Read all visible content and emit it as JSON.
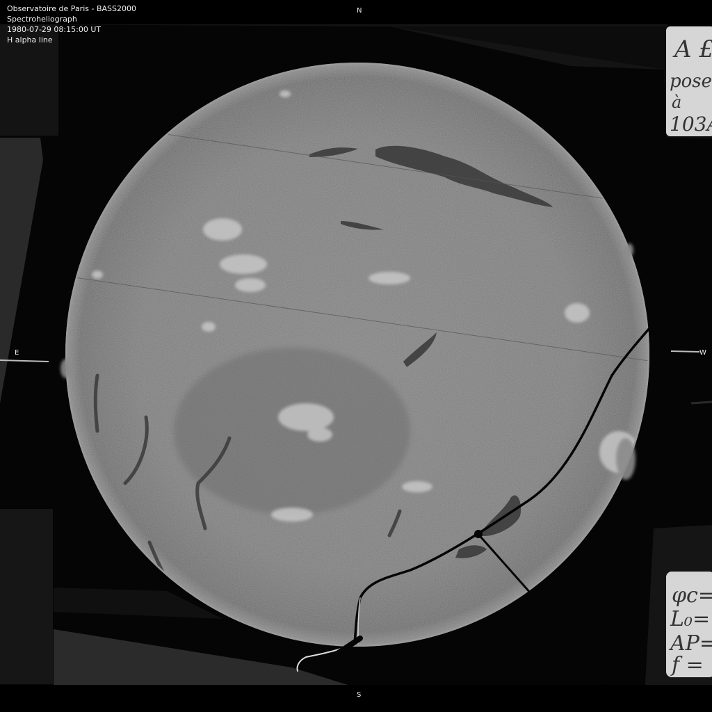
{
  "header": {
    "line1": "Observatoire de Paris - BASS2000",
    "line2": "Spectroheliograph",
    "line3": "1980-07-29 08:15:00 UT",
    "line4": "H alpha line"
  },
  "compass": {
    "north": "N",
    "south": "S",
    "east": "E",
    "west": "W"
  },
  "colors": {
    "background": "#000000",
    "disk": "#7d7d7d",
    "plate_edge": "#1a1a1a",
    "text": "#f0f0f0"
  },
  "handwritten_notes": {
    "top_right": "A ... pose à 103...",
    "bottom_right": "φc= L0= AP= f="
  }
}
